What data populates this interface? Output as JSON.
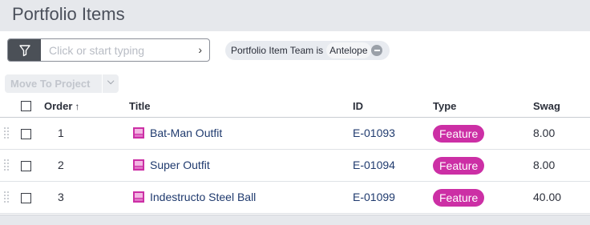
{
  "page": {
    "title": "Portfolio Items"
  },
  "filter": {
    "placeholder": "Click or start typing",
    "chip_label": "Portfolio Item Team is",
    "chip_value": "Antelope"
  },
  "toolbar": {
    "move_label": "Move To Project"
  },
  "table": {
    "columns": {
      "order": "Order",
      "title": "Title",
      "id": "ID",
      "type": "Type",
      "swag": "Swag"
    },
    "rows": [
      {
        "order": "1",
        "title": "Bat-Man Outfit",
        "id": "E-01093",
        "type": "Feature",
        "swag": "8.00"
      },
      {
        "order": "2",
        "title": "Super Outfit",
        "id": "E-01094",
        "type": "Feature",
        "swag": "8.00"
      },
      {
        "order": "3",
        "title": "Indestructo Steel Ball",
        "id": "E-01099",
        "type": "Feature",
        "swag": "40.00"
      }
    ]
  },
  "colors": {
    "feature_badge": "#cc2fa5",
    "link": "#1f3a6e",
    "filter_button": "#4b5057"
  },
  "icons": {
    "filter": "funnel-icon",
    "item": "feature-item-icon",
    "sort": "sort-ascending-icon"
  }
}
